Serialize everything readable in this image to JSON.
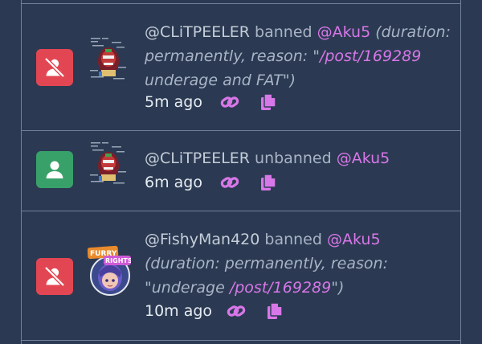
{
  "entries": [
    {
      "kind": "ban",
      "actor": "@CLiTPEELER",
      "verb": " banned ",
      "target": "@Aku5",
      "detail_prefix": " (duration: permanently, reason: \"",
      "detail_link": "/post/169289",
      "detail_suffix": " underage and FAT\")",
      "time": "5m ago"
    },
    {
      "kind": "unban",
      "actor": "@CLiTPEELER",
      "verb": " unbanned ",
      "target": "@Aku5",
      "time": "6m ago"
    },
    {
      "kind": "ban",
      "actor": "@FishyMan420",
      "verb": " banned ",
      "target": "@Aku5",
      "detail_prefix": " (duration: permanently, reason: \"underage ",
      "detail_link": "/post/169289",
      "detail_suffix": "\")",
      "avatar_text_1": "FURRY",
      "avatar_text_2": "RIGHTS",
      "time": "10m ago"
    }
  ],
  "icons": {
    "ban": "user-slash-icon",
    "unban": "user-icon",
    "permalink": "link-icon",
    "copy": "copy-icon"
  },
  "colors": {
    "background": "#2b3a52",
    "ban_badge": "#e34653",
    "unban_badge": "#38a169",
    "accent": "#d877e8"
  }
}
